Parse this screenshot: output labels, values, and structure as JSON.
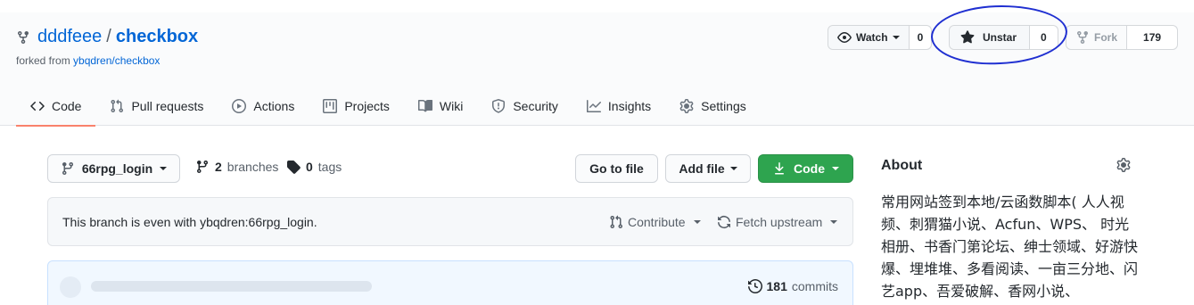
{
  "repo": {
    "owner": "dddfeee",
    "separator": "/",
    "name": "checkbox",
    "forked_prefix": "forked from ",
    "forked_source": "ybqdren/checkbox"
  },
  "actions": {
    "watch_label": "Watch",
    "watch_count": "0",
    "star_label": "Unstar",
    "star_count": "0",
    "fork_label": "Fork",
    "fork_count": "179"
  },
  "tabs": [
    {
      "label": "Code",
      "icon": "code-icon",
      "active": true
    },
    {
      "label": "Pull requests",
      "icon": "pull-request-icon"
    },
    {
      "label": "Actions",
      "icon": "play-icon"
    },
    {
      "label": "Projects",
      "icon": "project-icon"
    },
    {
      "label": "Wiki",
      "icon": "book-icon"
    },
    {
      "label": "Security",
      "icon": "shield-icon"
    },
    {
      "label": "Insights",
      "icon": "graph-icon"
    },
    {
      "label": "Settings",
      "icon": "gear-icon"
    }
  ],
  "toolbar": {
    "branch": "66rpg_login",
    "branches_count": "2",
    "branches_label": "branches",
    "tags_count": "0",
    "tags_label": "tags",
    "go_to_file": "Go to file",
    "add_file": "Add file",
    "code": "Code"
  },
  "branch_status": {
    "message": "This branch is even with ybqdren:66rpg_login.",
    "contribute": "Contribute",
    "fetch_upstream": "Fetch upstream"
  },
  "commits": {
    "count": "181",
    "label": "commits"
  },
  "about": {
    "title": "About",
    "description": "常用网站签到本地/云函数脚本( 人人视频、刺猬猫小说、Acfun、WPS、 时光相册、书香门第论坛、绅士领域、好游快爆、埋堆堆、多看阅读、一亩三分地、闪艺app、吾爱破解、香网小说、"
  },
  "colors": {
    "link": "#0366d6",
    "primary_button": "#2ea44f",
    "active_tab_underline": "#f9826c",
    "annotation": "#1f2fd1"
  }
}
